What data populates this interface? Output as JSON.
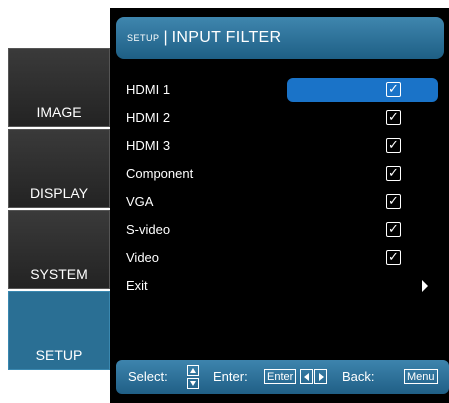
{
  "sidebar": {
    "items": [
      {
        "label": "IMAGE",
        "active": false
      },
      {
        "label": "DISPLAY",
        "active": false
      },
      {
        "label": "SYSTEM",
        "active": false
      },
      {
        "label": "SETUP",
        "active": true
      }
    ]
  },
  "header": {
    "sub": "SETUP",
    "separator": "|",
    "title": "INPUT FILTER"
  },
  "items": [
    {
      "label": "HDMI 1",
      "checked": true,
      "selected": true
    },
    {
      "label": "HDMI 2",
      "checked": true
    },
    {
      "label": "HDMI 3",
      "checked": true
    },
    {
      "label": "Component",
      "checked": true
    },
    {
      "label": "VGA",
      "checked": true
    },
    {
      "label": "S-video",
      "checked": true
    },
    {
      "label": "Video",
      "checked": true
    },
    {
      "label": "Exit",
      "submenu_icon": "arrow-right-icon"
    }
  ],
  "footer": {
    "select_label": "Select:",
    "enter_label": "Enter:",
    "enter_key": "Enter",
    "back_label": "Back:",
    "back_key": "Menu"
  },
  "colors": {
    "accent": "#2a6f94",
    "highlight": "#1a73c8",
    "panel_bg": "#000000"
  }
}
